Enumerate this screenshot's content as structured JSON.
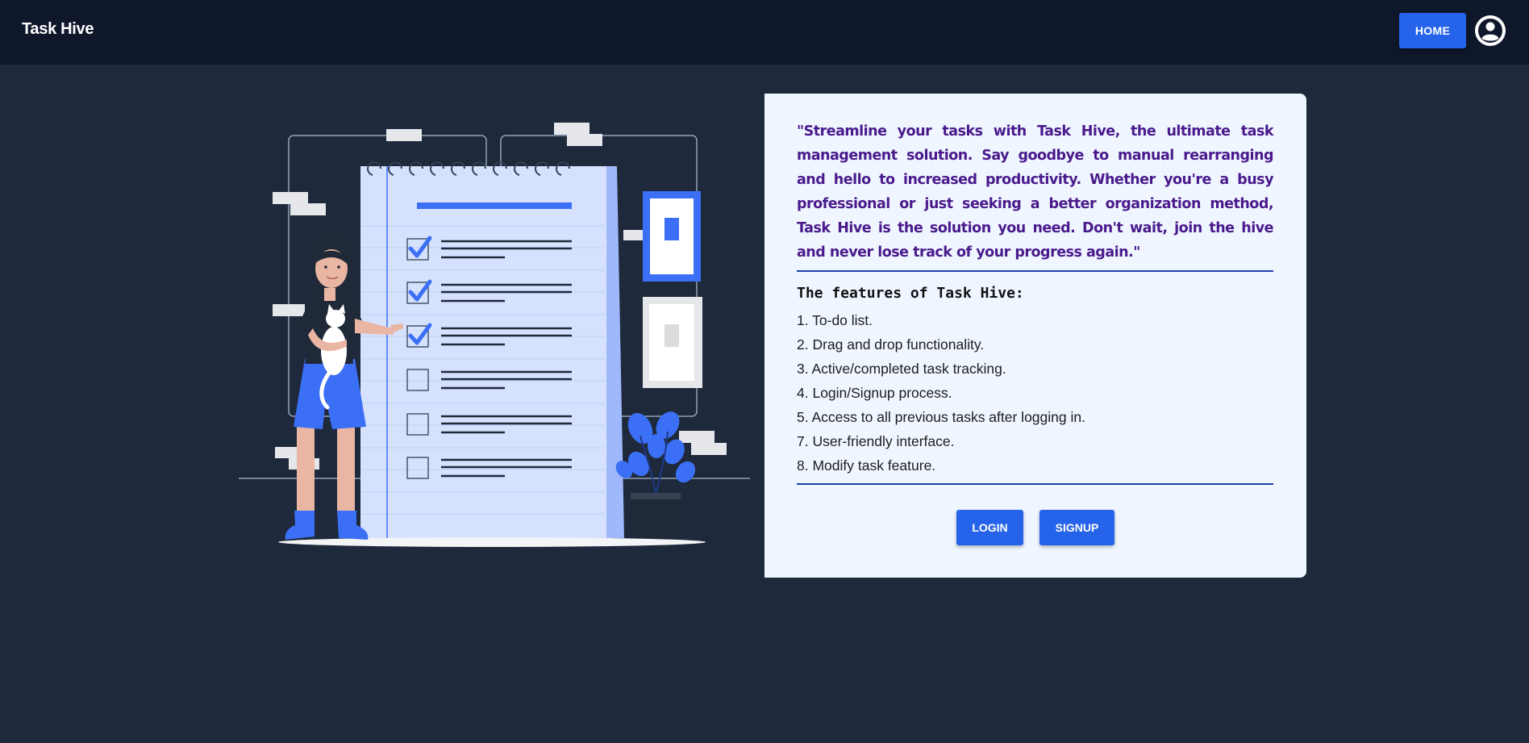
{
  "navbar": {
    "brand": "Task Hive",
    "home_label": "HOME",
    "profile_icon": "account-circle-icon"
  },
  "card": {
    "quote": "\"Streamline your tasks with Task Hive, the ultimate task management solution. Say goodbye to manual rearranging and hello to increased productivity. Whether you're a busy professional or just seeking a better organization method, Task Hive is the solution you need. Don't wait, join the hive and never lose track of your progress again.\"",
    "features_title": "The features of Task Hive:",
    "features": [
      "1. To-do list.",
      "2. Drag and drop functionality.",
      "3. Active/completed task tracking.",
      "4. Login/Signup process.",
      "5. Access to all previous tasks after logging in.",
      "7. User-friendly interface.",
      "8. Modify task feature."
    ],
    "login_label": "LOGIN",
    "signup_label": "SIGNUP"
  },
  "colors": {
    "navbar_bg": "#0f172a",
    "page_bg": "#1e293b",
    "accent": "#2563eb",
    "card_bg": "#eff6ff",
    "quote_text": "#4a1a8c",
    "divider": "#1e40af"
  },
  "illustration": {
    "subject": "woman-with-cat-beside-checklist-illustration",
    "checklist_items_checked": 3,
    "checklist_items_total": 6
  }
}
